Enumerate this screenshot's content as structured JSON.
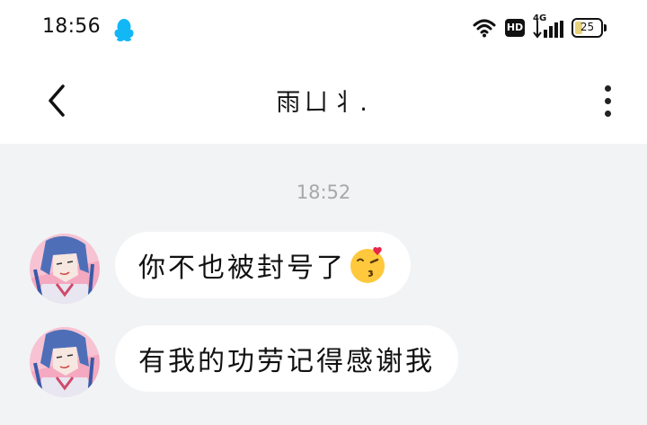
{
  "status_bar": {
    "time": "18:56",
    "signal_label": "4G",
    "hd_label": "HD",
    "battery_level": "25",
    "icons": [
      "qq-icon",
      "wifi-icon",
      "hd-icon",
      "signal-icon",
      "battery-icon"
    ]
  },
  "header": {
    "title": "雨ㄩ丬.",
    "back_icon": "chevron-left-icon",
    "more_icon": "more-vertical-icon"
  },
  "chat": {
    "timestamp": "18:52",
    "messages": [
      {
        "sender": "other",
        "text": "你不也被封号了",
        "emoji": "kissing-face-emoji"
      },
      {
        "sender": "other",
        "text": "有我的功劳记得感谢我"
      }
    ]
  },
  "colors": {
    "chat_background": "#f2f3f5",
    "bubble": "#ffffff",
    "qq_blue": "#12b7f5",
    "timestamp": "#a8a8a8"
  }
}
